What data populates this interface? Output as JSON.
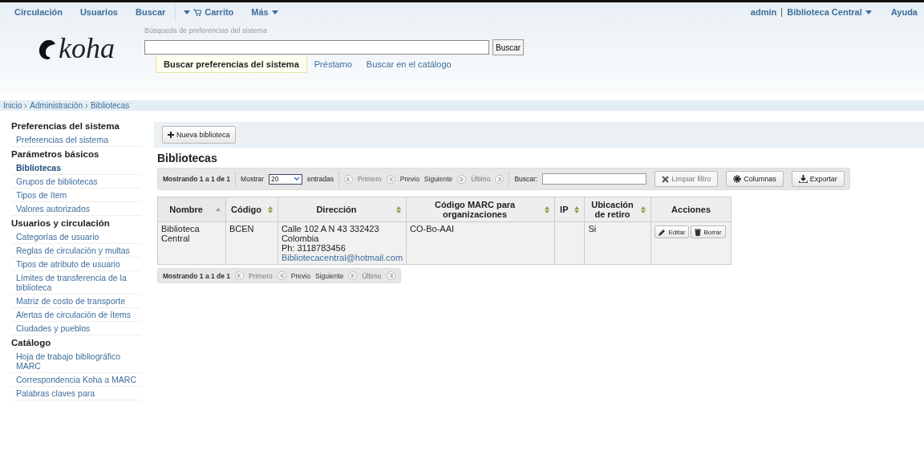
{
  "nav": {
    "items": [
      {
        "label": "Circulación",
        "kind": "link"
      },
      {
        "label": "Usuarios",
        "kind": "link"
      },
      {
        "label": "Buscar",
        "kind": "link"
      },
      {
        "label": "Carrito",
        "kind": "cart"
      },
      {
        "label": "Más",
        "kind": "menu"
      }
    ],
    "user": "admin",
    "library": "Biblioteca Central",
    "help": "Ayuda"
  },
  "header": {
    "logo": "koha",
    "search_label": "Búsqueda de preferencias del sistema",
    "search_button": "Buscar",
    "tabs": [
      {
        "label": "Buscar preferencias del sistema",
        "selected": true
      },
      {
        "label": "Préstamo",
        "selected": false
      },
      {
        "label": "Buscar en el catálogo",
        "selected": false
      }
    ]
  },
  "breadcrumbs": [
    "Inicio",
    "Administración",
    "Bibliotecas"
  ],
  "sidebar": [
    {
      "title": "Preferencias del sistema",
      "items": [
        {
          "label": "Preferencias del sistema",
          "selected": false
        }
      ]
    },
    {
      "title": "Parámetros básicos",
      "items": [
        {
          "label": "Bibliotecas",
          "selected": true
        },
        {
          "label": "Grupos de bibliotecas",
          "selected": false
        },
        {
          "label": "Tipos de ítem",
          "selected": false
        },
        {
          "label": "Valores autorizados",
          "selected": false
        }
      ]
    },
    {
      "title": "Usuarios y circulación",
      "items": [
        {
          "label": "Categorías de usuario",
          "selected": false
        },
        {
          "label": "Reglas de circulación y multas",
          "selected": false
        },
        {
          "label": "Tipos de atributo de usuario",
          "selected": false
        },
        {
          "label": "Límites de transferencia de la biblioteca",
          "selected": false
        },
        {
          "label": "Matriz de costo de transporte",
          "selected": false
        },
        {
          "label": "Alertas de circulación de ítems",
          "selected": false
        },
        {
          "label": "Ciudades y pueblos",
          "selected": false
        }
      ]
    },
    {
      "title": "Catálogo",
      "items": [
        {
          "label": "Hoja de trabajo bibliográfico MARC",
          "selected": false
        },
        {
          "label": "Correspondencia Koha a MARC",
          "selected": false
        },
        {
          "label": "Palabras claves para",
          "selected": false
        }
      ]
    }
  ],
  "toolbar": {
    "new_button": "Nueva biblioteca"
  },
  "title": "Bibliotecas",
  "top_pager": {
    "info": "Mostrando 1 a 1 de 1",
    "show_label": "Mostrar",
    "page_size": "20",
    "entries_label": "entradas",
    "search_label": "Buscar:",
    "links": [
      {
        "label": "Primero",
        "disabled": true
      },
      {
        "label": "Previo",
        "disabled": false
      },
      {
        "label": "Siguiente",
        "disabled": false
      },
      {
        "label": "Último",
        "disabled": true
      }
    ],
    "buttons": [
      {
        "label": "Limpiar filtro",
        "kind": "clear",
        "disabled": true
      },
      {
        "label": "Columnas",
        "kind": "columns",
        "disabled": false
      },
      {
        "label": "Exportar",
        "kind": "export",
        "disabled": false
      }
    ]
  },
  "table": {
    "columns": [
      {
        "label": "Nombre",
        "sortable": true,
        "sorted": true
      },
      {
        "label": "Código",
        "sortable": true,
        "sorted": false
      },
      {
        "label": "Dirección",
        "sortable": true,
        "sorted": false
      },
      {
        "label": "Código MARC para organizaciones",
        "sortable": true,
        "sorted": false
      },
      {
        "label": "IP",
        "sortable": true,
        "sorted": false
      },
      {
        "label": "Ubicación de retiro",
        "sortable": true,
        "sorted": false
      },
      {
        "label": "Acciones",
        "sortable": false
      }
    ],
    "rows": [
      {
        "name": "Biblioteca Central",
        "code": "BCEN",
        "address": [
          "Calle 102 A N 43 332423",
          "Colombia",
          "Ph: 3118783456"
        ],
        "email": "Bibliotecacentral@hotmail.com",
        "marc": "CO-Bo-AAI",
        "pickup": "Si",
        "actions": [
          {
            "label": "Editar",
            "kind": "edit"
          },
          {
            "label": "Borrar",
            "kind": "delete"
          }
        ]
      }
    ]
  },
  "bottom_pager": {
    "info": "Mostrando 1 a 1 de 1",
    "links": [
      {
        "label": "Primero",
        "disabled": true
      },
      {
        "label": "Previo",
        "disabled": false
      },
      {
        "label": "Siguiente",
        "disabled": false
      },
      {
        "label": "Último",
        "disabled": true
      }
    ]
  }
}
